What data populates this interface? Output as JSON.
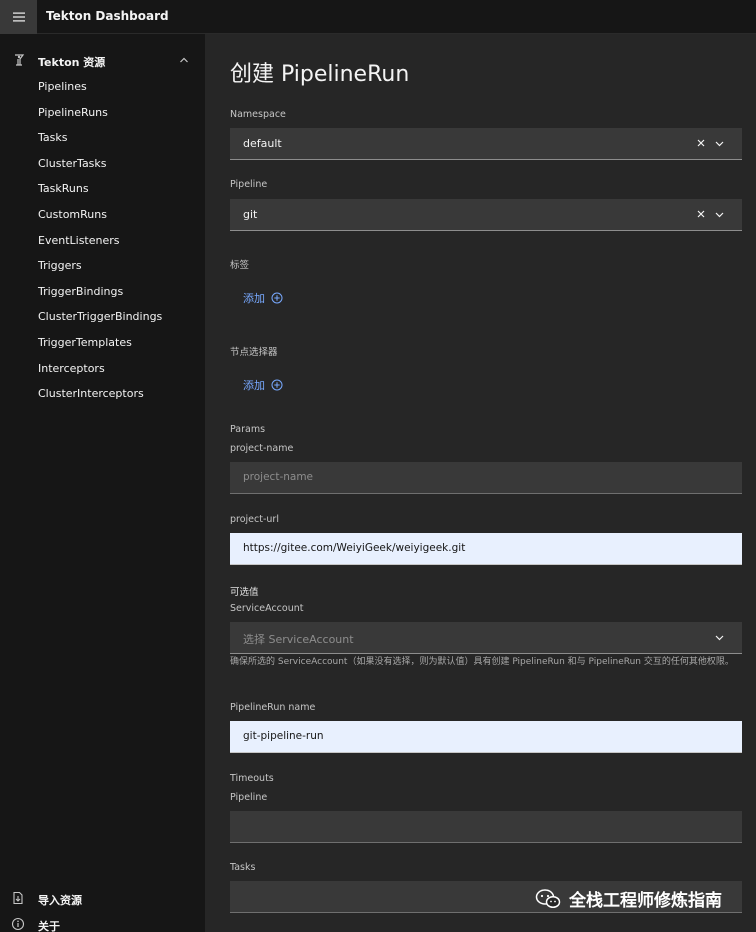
{
  "header": {
    "title_bold": "Tekton",
    "title_rest": "Dashboard"
  },
  "sidebar": {
    "section_label": "Tekton 资源",
    "items": [
      "Pipelines",
      "PipelineRuns",
      "Tasks",
      "ClusterTasks",
      "TaskRuns",
      "CustomRuns",
      "EventListeners",
      "Triggers",
      "TriggerBindings",
      "ClusterTriggerBindings",
      "TriggerTemplates",
      "Interceptors",
      "ClusterInterceptors"
    ],
    "footer": {
      "import_label": "导入资源",
      "about_label": "关于"
    }
  },
  "main": {
    "title": "创建 PipelineRun",
    "namespace": {
      "label": "Namespace",
      "value": "default"
    },
    "pipeline": {
      "label": "Pipeline",
      "value": "git"
    },
    "labels": {
      "label": "标签",
      "add_label": "添加"
    },
    "node_selector": {
      "label": "节点选择器",
      "add_label": "添加"
    },
    "params": {
      "label": "Params",
      "project_name": {
        "label": "project-name",
        "placeholder": "project-name"
      },
      "project_url": {
        "label": "project-url",
        "value": "https://gitee.com/WeiyiGeek/weiyigeek.git"
      }
    },
    "optional": {
      "label": "可选值",
      "service_account": {
        "label": "ServiceAccount",
        "placeholder": "选择 ServiceAccount",
        "helper": "确保所选的 ServiceAccount（如果没有选择，则为默认值）具有创建 PipelineRun 和与 PipelineRun 交互的任何其他权限。"
      }
    },
    "run_name": {
      "label": "PipelineRun name",
      "value": "git-pipeline-run"
    },
    "timeouts": {
      "label": "Timeouts",
      "pipeline_label": "Pipeline",
      "pipeline_value": "",
      "tasks_label": "Tasks",
      "tasks_value": ""
    }
  },
  "watermark": {
    "text": "全栈工程师修炼指南"
  }
}
